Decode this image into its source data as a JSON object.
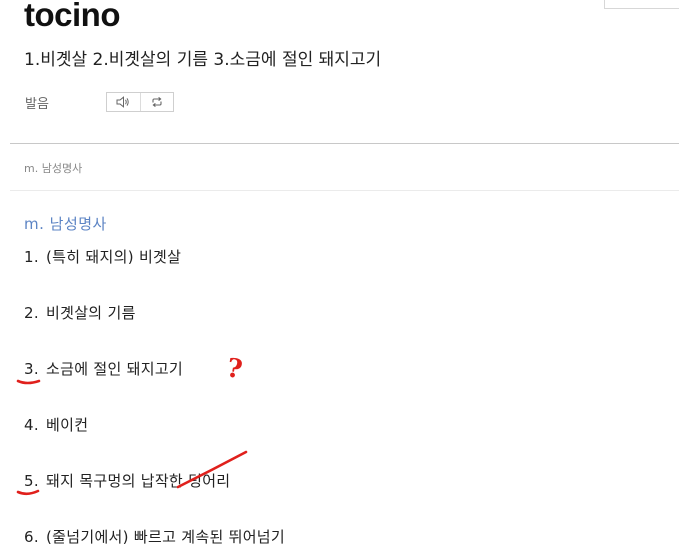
{
  "entry": {
    "headword": "tocino",
    "summary": "1.비곗살 2.비곗살의 기름 3.소금에 절인 돼지고기"
  },
  "pronunciation": {
    "label": "발음",
    "play_icon": "speaker-icon",
    "repeat_icon": "repeat-icon"
  },
  "pos_small": "m. 남성명사",
  "pos_heading": "m. 남성명사",
  "senses": [
    {
      "num": "1.",
      "text": "(특히 돼지의) 비곗살"
    },
    {
      "num": "2.",
      "text": "비곗살의 기름"
    },
    {
      "num": "3.",
      "text": "소금에 절인 돼지고기"
    },
    {
      "num": "4.",
      "text": "베이컨"
    },
    {
      "num": "5.",
      "text": "돼지 목구멍의 납작한 덩어리"
    },
    {
      "num": "6.",
      "text": "(줄넘기에서) 빠르고 계속된 뛰어넘기"
    }
  ],
  "annotations": {
    "question_mark": "?",
    "ink_color": "#e0201c"
  },
  "colors": {
    "pos_blue": "#5c84c4",
    "text": "#222222"
  }
}
